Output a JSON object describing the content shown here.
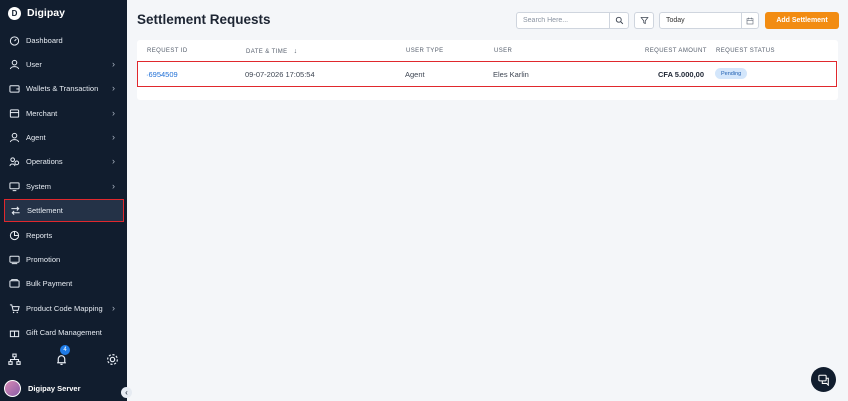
{
  "brand": {
    "name": "Digipay",
    "logo_letter": "D"
  },
  "sidebar": {
    "items": [
      {
        "label": "Dashboard",
        "icon": "dashboard-icon",
        "has_chevron": false
      },
      {
        "label": "User",
        "icon": "user-icon",
        "has_chevron": true
      },
      {
        "label": "Wallets & Transaction",
        "icon": "wallet-icon",
        "has_chevron": true
      },
      {
        "label": "Merchant",
        "icon": "merchant-icon",
        "has_chevron": true
      },
      {
        "label": "Agent",
        "icon": "agent-icon",
        "has_chevron": true
      },
      {
        "label": "Operations",
        "icon": "operations-icon",
        "has_chevron": true
      },
      {
        "label": "System",
        "icon": "monitor-icon",
        "has_chevron": true
      },
      {
        "label": "Settlement",
        "icon": "swap-arrows-icon",
        "has_chevron": false,
        "active": true
      },
      {
        "label": "Reports",
        "icon": "pie-chart-icon",
        "has_chevron": false
      },
      {
        "label": "Promotion",
        "icon": "promotion-icon",
        "has_chevron": false
      },
      {
        "label": "Bulk Payment",
        "icon": "bulk-payment-icon",
        "has_chevron": false
      },
      {
        "label": "Product Code Mapping",
        "icon": "cart-icon",
        "has_chevron": true
      },
      {
        "label": "Gift Card Management",
        "icon": "gift-icon",
        "has_chevron": false
      }
    ],
    "notification_count": "4",
    "profile_name": "Digipay Server"
  },
  "header": {
    "title": "Settlement Requests",
    "search_placeholder": "Search Here...",
    "date_value": "Today",
    "add_button": "Add Settlement"
  },
  "table": {
    "columns": [
      "REQUEST ID",
      "DATE & TIME",
      "USER TYPE",
      "USER",
      "REQUEST AMOUNT",
      "REQUEST STATUS"
    ],
    "sort_indicator": "↓",
    "rows": [
      {
        "request_id": "6954509",
        "datetime": "09-07-2026 17:05:54",
        "user_type": "Agent",
        "user": "Eles Karlin",
        "amount": "CFA 5.000,00",
        "status": "Pending"
      }
    ]
  },
  "colors": {
    "sidebar_bg": "#111d2e",
    "accent": "#f28c12",
    "highlight": "#e0282d",
    "link": "#1f6fd6"
  }
}
